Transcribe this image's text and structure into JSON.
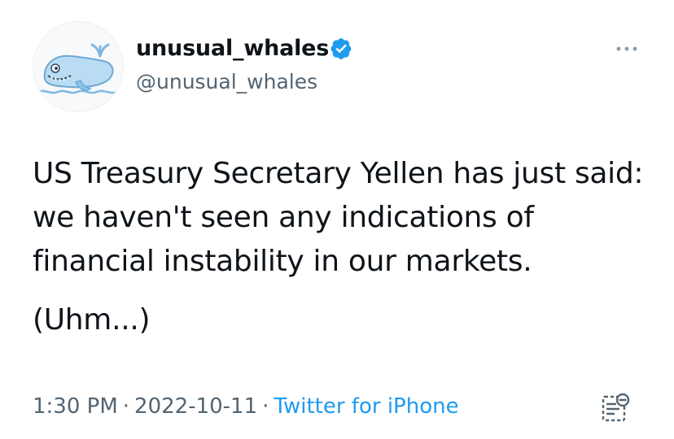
{
  "tweet": {
    "author": {
      "display_name": "unusual_whales",
      "handle": "@unusual_whales",
      "verified": true,
      "avatar_icon": "whale-avatar"
    },
    "text_paragraphs": [
      "US Treasury Secretary Yellen has just said: we haven't seen any indications of financial instability in our markets.",
      "(Uhm...)"
    ],
    "time": "1:30 PM",
    "date": "2022-10-11",
    "separator": "·",
    "source": "Twitter for iPhone",
    "icons": {
      "more": "more-options-icon",
      "verified": "verified-badge-icon",
      "activity": "tweet-activity-icon"
    }
  },
  "colors": {
    "text_primary": "#0f1419",
    "text_secondary": "#536471",
    "link": "#1d9bf0",
    "verified": "#1d9bf0",
    "whale_blue": "#b9dcf3"
  }
}
